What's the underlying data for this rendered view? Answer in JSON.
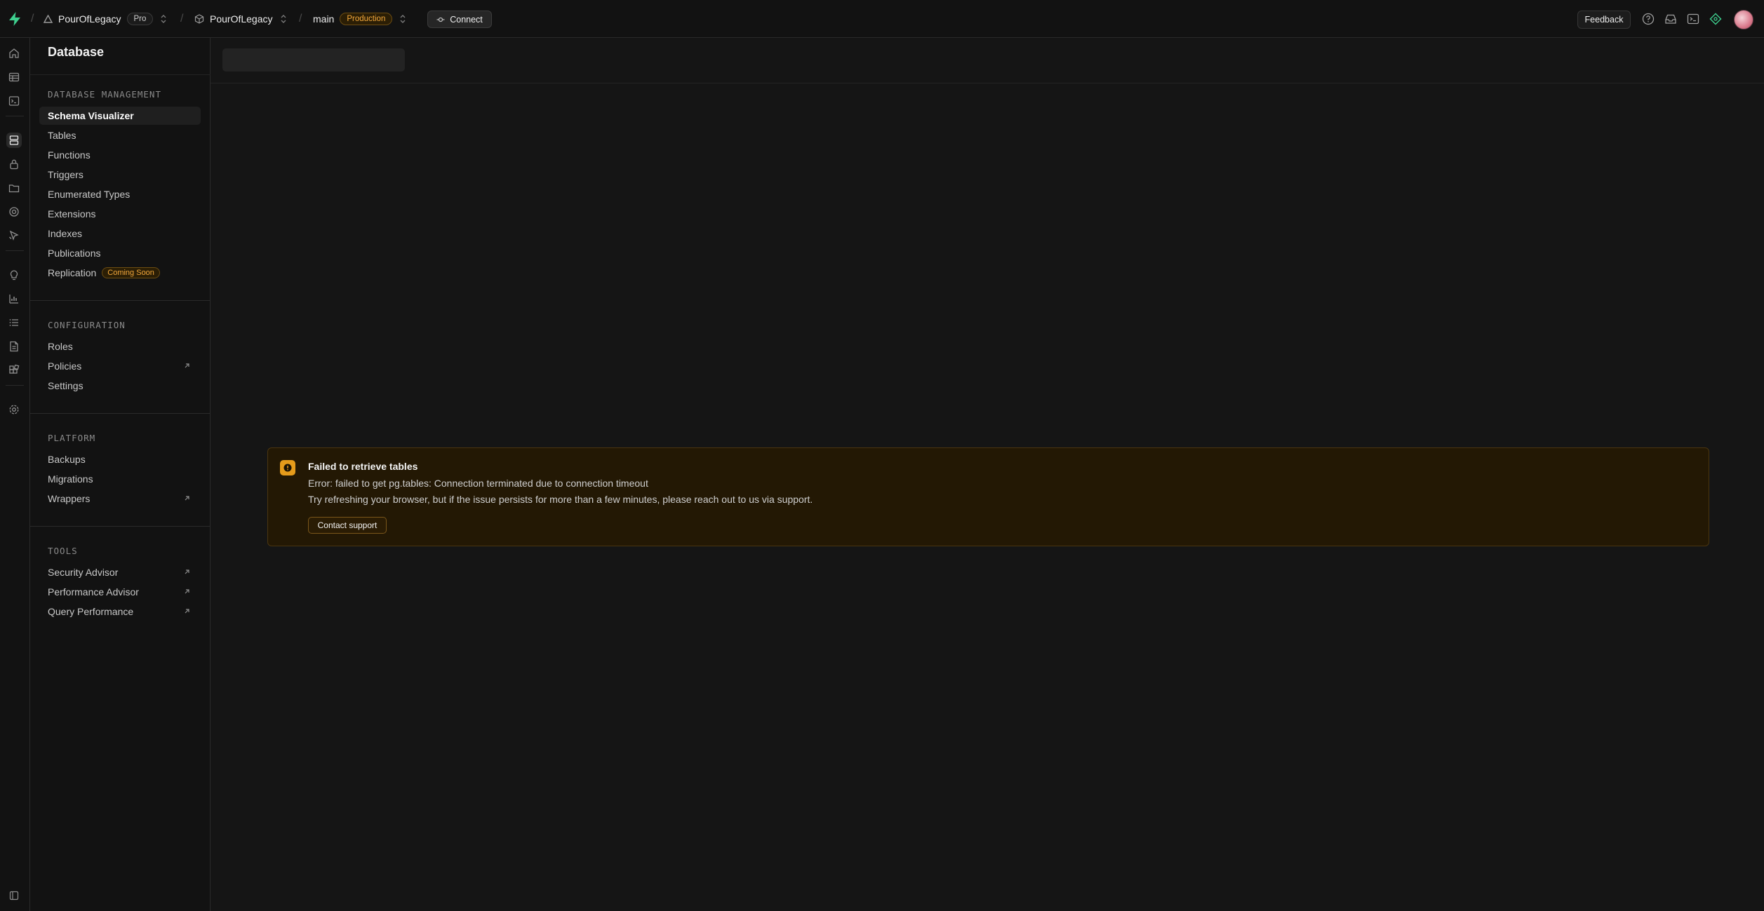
{
  "topbar": {
    "org_name": "PourOfLegacy",
    "org_plan": "Pro",
    "project_name": "PourOfLegacy",
    "branch_name": "main",
    "branch_env": "Production",
    "connect_label": "Connect",
    "feedback_label": "Feedback"
  },
  "sidebar": {
    "title": "Database",
    "sections": [
      {
        "title": "DATABASE MANAGEMENT",
        "items": [
          {
            "label": "Schema Visualizer"
          },
          {
            "label": "Tables"
          },
          {
            "label": "Functions"
          },
          {
            "label": "Triggers"
          },
          {
            "label": "Enumerated Types"
          },
          {
            "label": "Extensions"
          },
          {
            "label": "Indexes"
          },
          {
            "label": "Publications"
          },
          {
            "label": "Replication",
            "badge": "Coming Soon"
          }
        ]
      },
      {
        "title": "CONFIGURATION",
        "items": [
          {
            "label": "Roles"
          },
          {
            "label": "Policies"
          },
          {
            "label": "Settings"
          }
        ]
      },
      {
        "title": "PLATFORM",
        "items": [
          {
            "label": "Backups"
          },
          {
            "label": "Migrations"
          },
          {
            "label": "Wrappers"
          }
        ]
      },
      {
        "title": "TOOLS",
        "items": [
          {
            "label": "Security Advisor"
          },
          {
            "label": "Performance Advisor"
          },
          {
            "label": "Query Performance"
          }
        ]
      }
    ]
  },
  "alert": {
    "title": "Failed to retrieve tables",
    "error": "Error: failed to get pg.tables: Connection terminated due to connection timeout",
    "hint": "Try refreshing your browser, but if the issue persists for more than a few minutes, please reach out to us via support.",
    "button": "Contact support"
  },
  "colors": {
    "brand": "#3ecf8e",
    "warning": "#e59b1b",
    "background": "#151515"
  }
}
